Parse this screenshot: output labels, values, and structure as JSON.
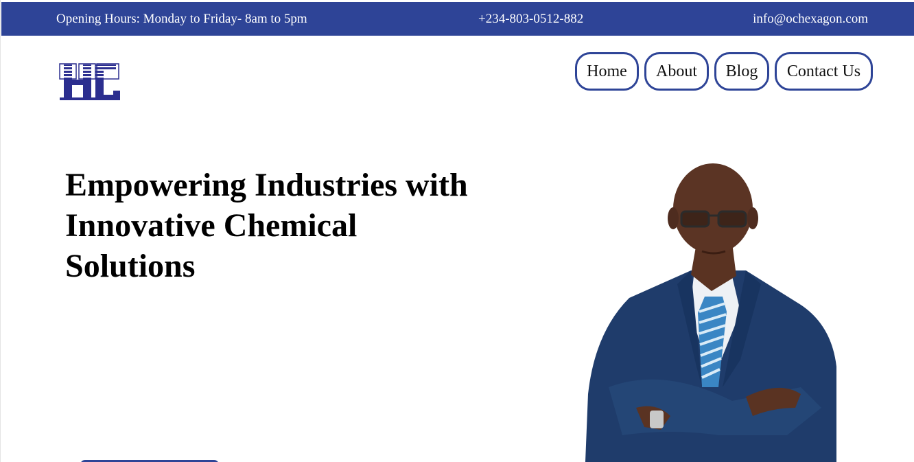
{
  "topbar": {
    "hours": "Opening Hours: Monday to Friday- 8am to 5pm",
    "phone": "+234-803-0512-882",
    "email": "info@ochexagon.com"
  },
  "nav": {
    "items": [
      {
        "label": "Home"
      },
      {
        "label": "About"
      },
      {
        "label": "Blog"
      },
      {
        "label": "Contact Us"
      }
    ]
  },
  "hero": {
    "title_line1": "Empowering Industries with",
    "title_line2": "Innovative Chemical",
    "title_line3": "Solutions"
  },
  "colors": {
    "brand": "#2e4497",
    "text": "#000000",
    "background": "#ffffff"
  },
  "icons": {
    "logo": "hc-logo",
    "hero_image": "businessman-portrait"
  }
}
